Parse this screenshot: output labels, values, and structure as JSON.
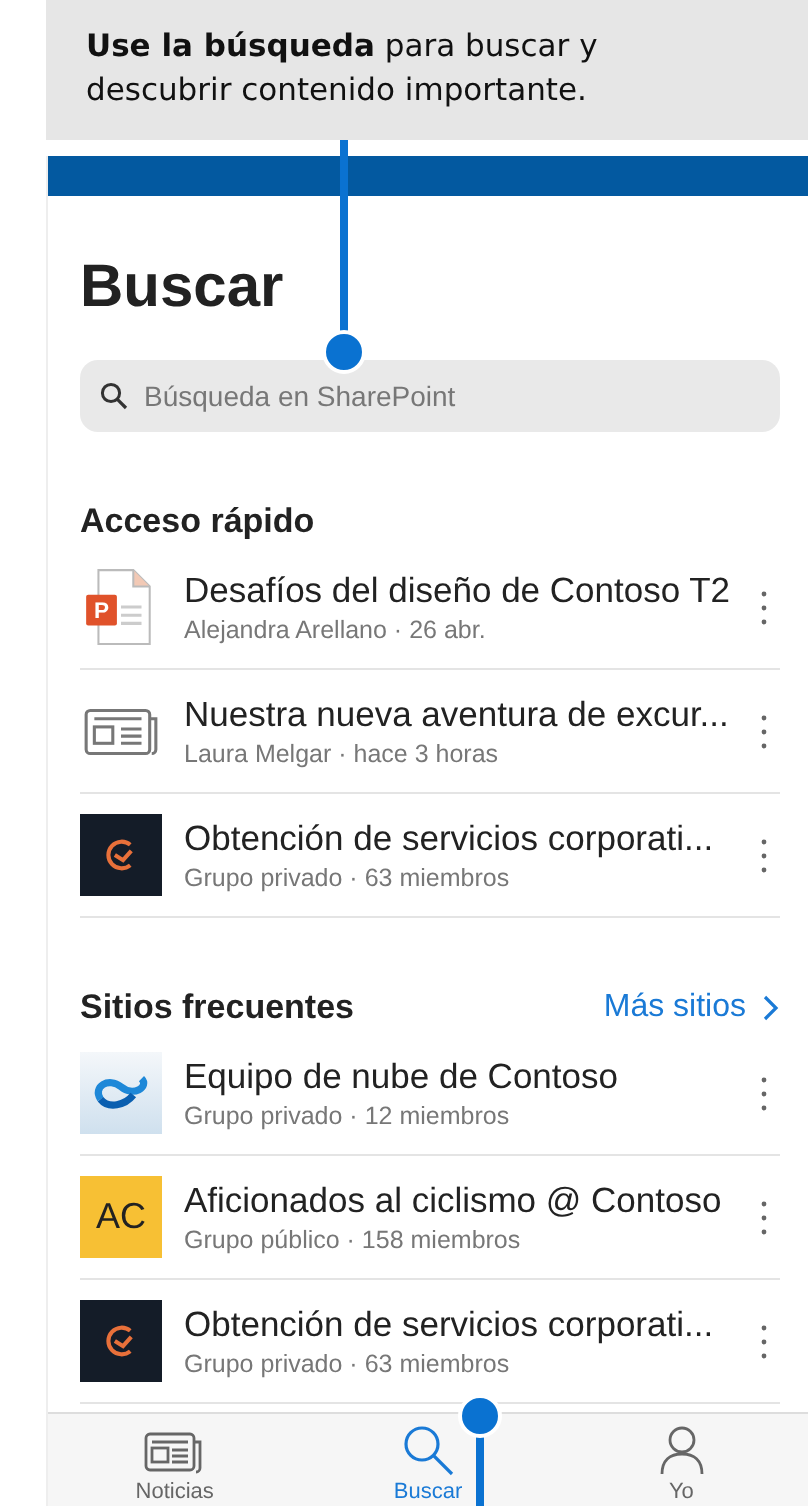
{
  "callout": {
    "text": "**Use la búsqueda** para buscar y descubrir contenido importante."
  },
  "page_title": "Buscar",
  "search": {
    "placeholder": "Búsqueda en SharePoint"
  },
  "sections": [
    {
      "title": "Acceso rápido",
      "items": [
        {
          "kind": "powerpoint",
          "badge": "P",
          "title": "Desafíos del diseño de Contoso T2",
          "subtitle": "Alejandra Arellano · 26 abr."
        },
        {
          "kind": "news",
          "title": "Nuestra nueva aventura de excur...",
          "subtitle": "Laura Melgar · hace 3 horas"
        },
        {
          "kind": "dark-logo",
          "title": "Obtención de servicios corporati...",
          "subtitle": "Grupo privado · 63 miembros"
        }
      ]
    },
    {
      "title": "Sitios frecuentes",
      "link": "Más sitios",
      "items": [
        {
          "kind": "cloud-logo",
          "title": "Equipo de nube de Contoso",
          "subtitle": "Grupo privado · 12 miembros"
        },
        {
          "kind": "initials",
          "initials": "AC",
          "title": "Aficionados al ciclismo @ Contoso",
          "subtitle": "Grupo público · 158 miembros"
        },
        {
          "kind": "dark-logo",
          "title": "Obtención de servicios corporati...",
          "subtitle": "Grupo privado · 63 miembros"
        }
      ]
    }
  ],
  "tab_bar": [
    {
      "kind": "news",
      "label": "Noticias",
      "selected": false
    },
    {
      "kind": "search",
      "label": "Buscar",
      "selected": true
    },
    {
      "kind": "person",
      "label": "Yo",
      "selected": false
    }
  ]
}
